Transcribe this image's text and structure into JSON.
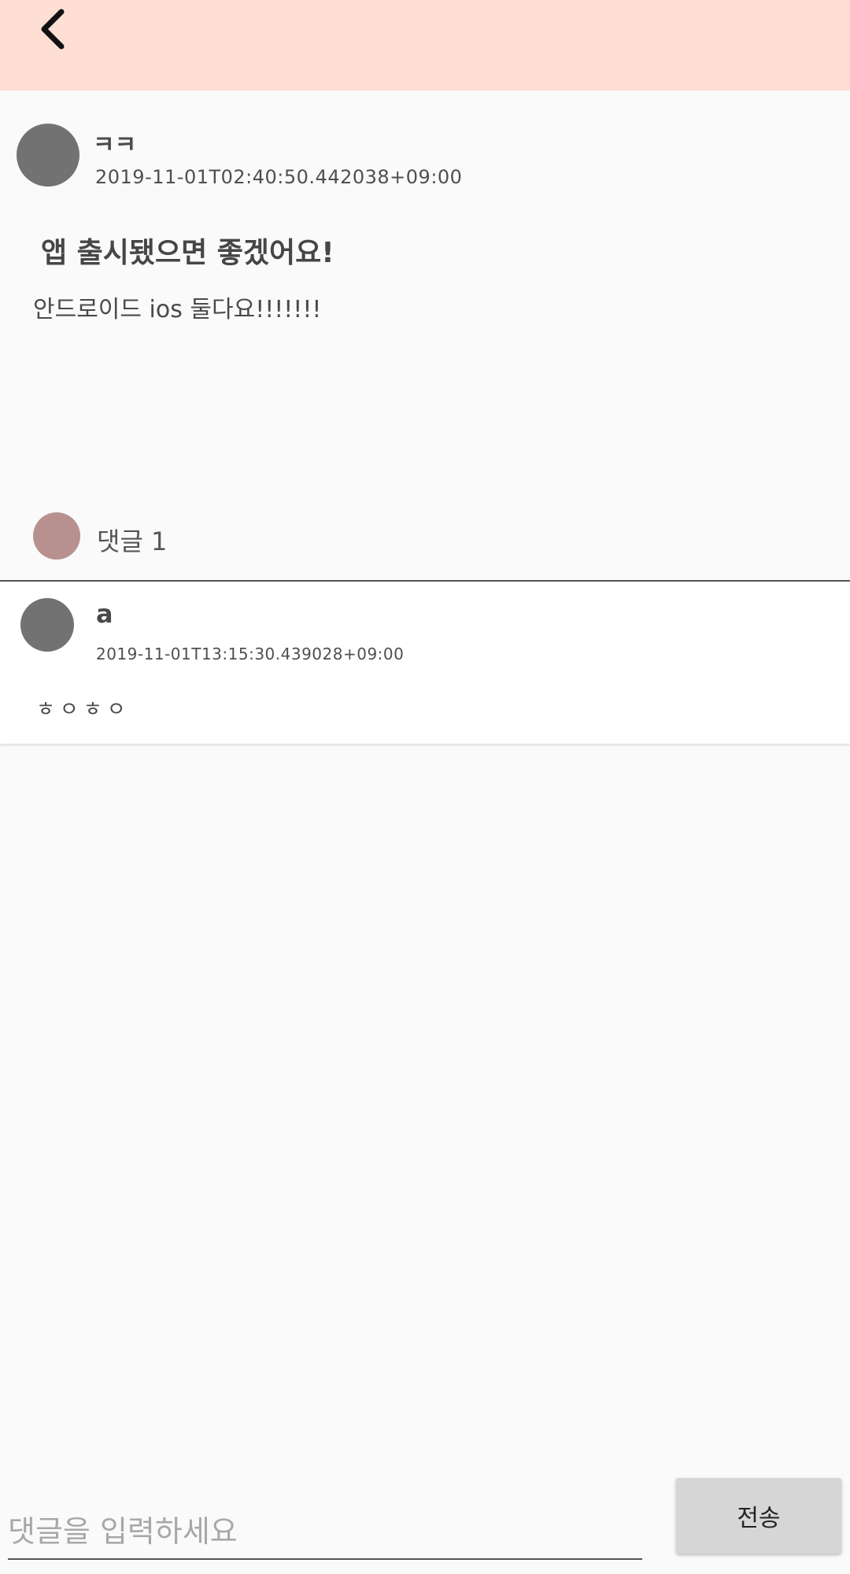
{
  "appbar": {
    "back_icon": "chevron-left-icon",
    "background": "#ffdfd4"
  },
  "post": {
    "author": "ㅋㅋ",
    "timestamp": "2019-11-01T02:40:50.442038+09:00",
    "title": "앱 출시됐으면 좋겠어요!",
    "body": "안드로이드 ios 둘다요!!!!!!!",
    "comment_label": "댓글 1"
  },
  "comments": [
    {
      "author": "a",
      "timestamp": "2019-11-01T13:15:30.439028+09:00",
      "body": "ㅎㅇㅎㅇ"
    }
  ],
  "composer": {
    "placeholder": "댓글을 입력하세요",
    "value": "",
    "send_label": "전송"
  },
  "colors": {
    "avatar": "#727272",
    "comment_badge": "#b89090",
    "page_background": "#fafafa"
  }
}
